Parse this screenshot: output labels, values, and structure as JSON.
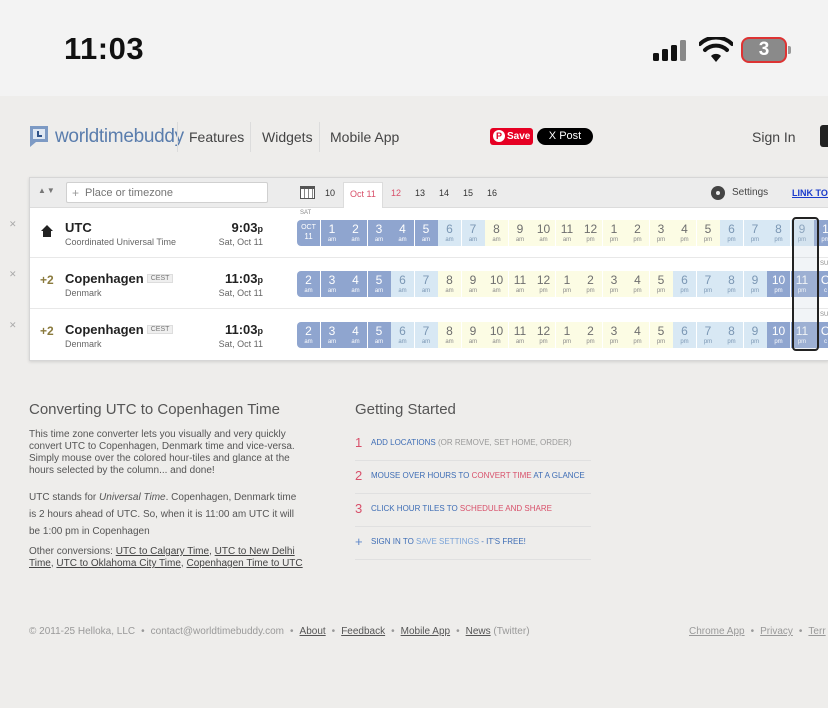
{
  "status_bar": {
    "time": "11:03",
    "battery": "3"
  },
  "nav": {
    "logo": "worldtimebuddy",
    "links": [
      "Features",
      "Widgets",
      "Mobile App"
    ],
    "save": "Save",
    "post": "X Post",
    "sign_in": "Sign In"
  },
  "toolbar": {
    "search_placeholder": "Place or timezone",
    "dates": [
      "10",
      "Oct 11",
      "12",
      "13",
      "14",
      "15",
      "16"
    ],
    "settings": "Settings",
    "link_to": "LINK TO T"
  },
  "rows": [
    {
      "offset": "",
      "city": "UTC",
      "abbr": "",
      "subtitle": "Coordinated Universal Time",
      "time": "9:03",
      "ampm": "p",
      "date": "Sat, Oct 11",
      "day": "SAT"
    },
    {
      "offset": "+2",
      "city": "Copenhagen",
      "abbr": "CEST",
      "subtitle": "Denmark",
      "time": "11:03",
      "ampm": "p",
      "date": "Sat, Oct 11",
      "day": "SU"
    },
    {
      "offset": "+2",
      "city": "Copenhagen",
      "abbr": "CEST",
      "subtitle": "Denmark",
      "time": "11:03",
      "ampm": "p",
      "date": "Sat, Oct 11",
      "day": "SU"
    }
  ],
  "strips": [
    [
      "OCT|11|d",
      "1|am|n",
      "2|am|n",
      "3|am|n",
      "4|am|n",
      "5|am|n",
      "6|am|m",
      "7|am|m",
      "8|am|d",
      "9|am|d",
      "10|am|d",
      "11|am|d",
      "12|pm|d",
      "1|pm|d",
      "2|pm|d",
      "3|pm|d",
      "4|pm|d",
      "5|pm|d",
      "6|pm|m",
      "7|pm|m",
      "8|pm|m",
      "9|pm|m",
      "1|pm|n"
    ],
    [
      "2|am|n",
      "3|am|n",
      "4|am|n",
      "5|am|n",
      "6|am|m",
      "7|am|m",
      "8|am|d",
      "9|am|d",
      "10|am|d",
      "11|am|d",
      "12|pm|d",
      "1|pm|d",
      "2|pm|d",
      "3|pm|d",
      "4|pm|d",
      "5|pm|d",
      "6|pm|m",
      "7|pm|m",
      "8|pm|m",
      "9|pm|m",
      "10|pm|n",
      "11|pm|n",
      "O|c|n"
    ],
    [
      "2|am|n",
      "3|am|n",
      "4|am|n",
      "5|am|n",
      "6|am|m",
      "7|am|m",
      "8|am|d",
      "9|am|d",
      "10|am|d",
      "11|am|d",
      "12|pm|d",
      "1|pm|d",
      "2|pm|d",
      "3|pm|d",
      "4|pm|d",
      "5|pm|d",
      "6|pm|m",
      "7|pm|m",
      "8|pm|m",
      "9|pm|m",
      "10|pm|n",
      "11|pm|n",
      "O|c|n"
    ]
  ],
  "converting": {
    "title": "Converting UTC to Copenhagen Time",
    "p1": "This time zone converter lets you visually and very quickly convert UTC to Copenhagen, Denmark time and vice-versa. Simply mouse over the colored hour-tiles and glance at the hours selected by the column... and done!",
    "p2_a": "UTC stands for ",
    "p2_em": "Universal Time",
    "p2_b": ". Copenhagen, Denmark time is 2 hours ahead of UTC. So, when it is ",
    "p2_t1": "11:00 am UTC",
    "p2_c": " it will be ",
    "p2_t2": "1:00 pm in Copenhagen",
    "p3_lead": "Other conversions: ",
    "links": [
      "UTC to Calgary Time",
      "UTC to New Delhi Time",
      "UTC to Oklahoma City Time",
      "Copenhagen Time to UTC"
    ]
  },
  "getting_started": {
    "title": "Getting Started",
    "steps": [
      {
        "num": "1",
        "a": "ADD LOCATIONS",
        "b": " (OR REMOVE, SET HOME, ORDER)",
        "c": ""
      },
      {
        "num": "2",
        "a": "MOUSE OVER HOURS TO ",
        "b": "CONVERT TIME",
        "c": " AT A GLANCE"
      },
      {
        "num": "3",
        "a": "CLICK HOUR TILES TO ",
        "b": "SCHEDULE AND SHARE",
        "c": ""
      },
      {
        "num": "+",
        "a": "SIGN IN TO ",
        "b": "SAVE SETTINGS",
        "c": " - IT'S FREE!"
      }
    ]
  },
  "footer": {
    "copyright": "© 2011-25 Helloka, LLC",
    "email": "contact@worldtimebuddy.com",
    "about": "About",
    "feedback": "Feedback",
    "mobile": "Mobile App",
    "news": "News",
    "twitter": "(Twitter)",
    "chrome": "Chrome App",
    "privacy": "Privacy",
    "terms": "Terr"
  }
}
